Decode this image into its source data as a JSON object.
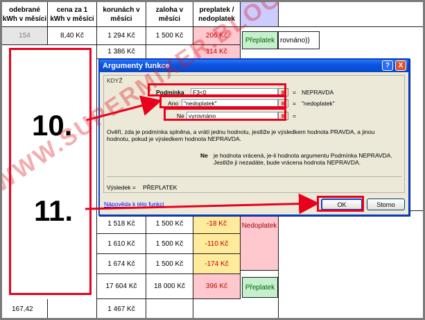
{
  "sheet": {
    "headers": {
      "col_a": [
        "odebrané",
        "kWh v měsíci"
      ],
      "col_b": [
        "cena za 1",
        "kWh v měsíci"
      ],
      "col_c": [
        "korunách v",
        "měsíci"
      ],
      "col_d": [
        "zaloha v",
        "měsíci"
      ],
      "col_e": [
        "preplatek /",
        "nedoplatek"
      ]
    },
    "row1": {
      "kwh": "154",
      "price": "8,40 Kč",
      "cost": "1 294 Kč",
      "advance": "1 500 Kč",
      "diff": "206 Kč",
      "status": "Přeplatek",
      "formula_tail": "rovnáno))"
    },
    "row2": {
      "cost": "1 386 Kč",
      "diff": "114 Kč"
    },
    "rows_below": [
      {
        "cost": "1 518 Kč",
        "advance": "1 500 Kč",
        "diff": "-18 Kč",
        "status": "Nedoplatek"
      },
      {
        "cost": "1 610 Kč",
        "advance": "1 500 Kč",
        "diff": "-110 Kč",
        "status": ""
      },
      {
        "cost": "1 674 Kč",
        "advance": "1 500 Kč",
        "diff": "-174 Kč",
        "status": ""
      }
    ],
    "total": {
      "cost": "17 604 Kč",
      "advance": "18 000 Kč",
      "diff": "396 Kč",
      "status": "Přeplatek"
    },
    "last": {
      "kwh": "167,42",
      "cost": "1 467 Kč"
    }
  },
  "dialog": {
    "title": "Argumenty funkce",
    "function_name": "KDYŽ",
    "args": [
      {
        "label": "Podmínka",
        "value": "F3<0",
        "result": "NEPRAVDA"
      },
      {
        "label": "Ano",
        "value": "\"nedoplatek\"",
        "result": "\"nedoplatek\""
      },
      {
        "label": "Ne",
        "value": "vyrovnáno",
        "result": ""
      }
    ],
    "equals": "=",
    "description": "Ověří, zda je podmínka splněna, a vrátí jednu hodnotu, jestliže je výsledkem hodnota PRAVDA, a jinou hodnotu, pokud je výsledkem hodnota NEPRAVDA.",
    "arg_help_name": "Ne",
    "arg_help_text": "je hodnota vrácená, je-li hodnota argumentu Podmínka NEPRAVDA. Jestliže ji nezadáte, bude vrácena hodnota NEPRAVDA.",
    "result_label": "Výsledek =",
    "result_value": "PŘEPLATEK",
    "help_link": "Nápověda k této funkci",
    "ok": "OK",
    "cancel": "Storno",
    "help_btn": "?",
    "close_btn": "X"
  },
  "annotations": {
    "step10": "10.",
    "step11": "11.",
    "watermark": "WWW.SUPERMIXER.BLOG.CZ"
  },
  "colors": {
    "red_annotation": "#e8001c",
    "title_blue": "#0a54e3"
  }
}
